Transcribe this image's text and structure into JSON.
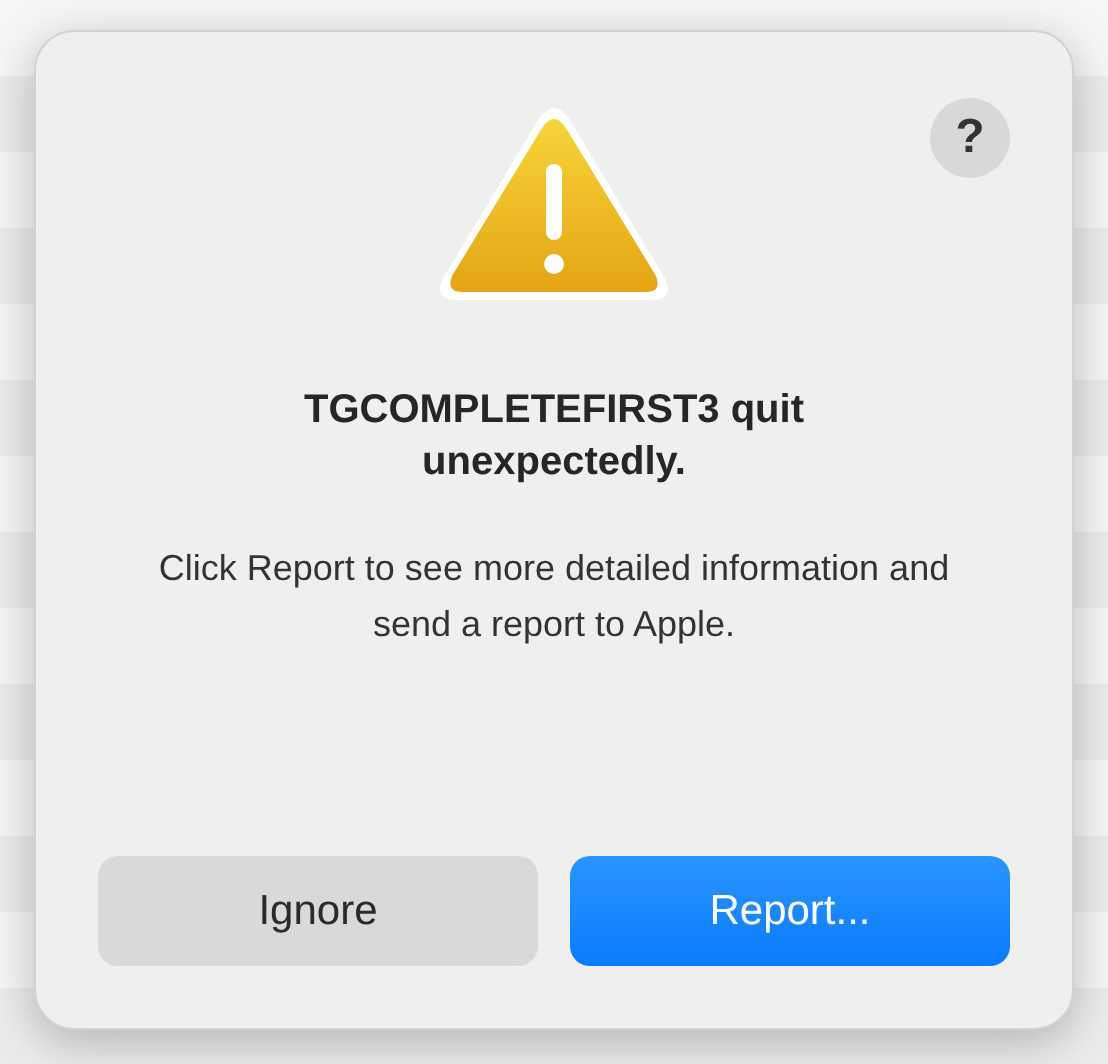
{
  "dialog": {
    "help_button": "?",
    "title": "TGCOMPLETEFIRST3 quit unexpectedly.",
    "message": "Click Report to see more detailed information and send a report to Apple.",
    "buttons": [
      {
        "label": "Ignore",
        "kind": "secondary"
      },
      {
        "label": "Report...",
        "kind": "default"
      }
    ]
  }
}
